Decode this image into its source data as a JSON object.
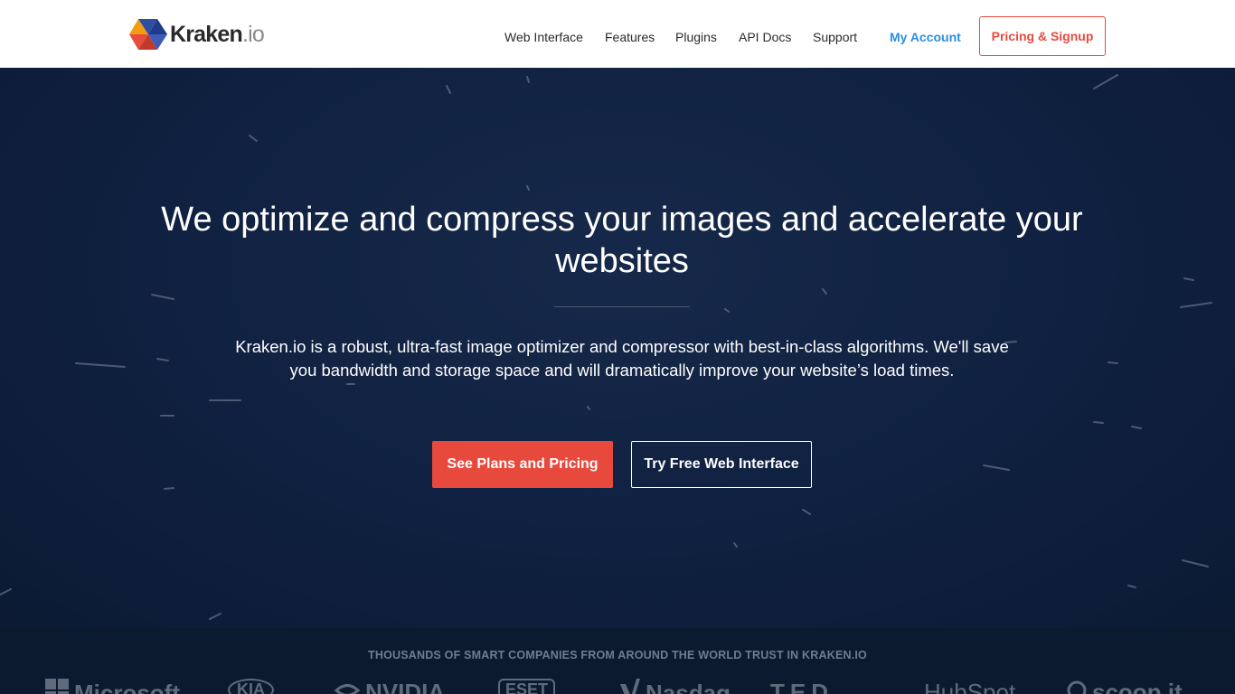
{
  "header": {
    "logo": {
      "name": "Kraken",
      "suffix": ".io"
    },
    "nav": [
      {
        "label": "Web Interface"
      },
      {
        "label": "Features"
      },
      {
        "label": "Plugins"
      },
      {
        "label": "API Docs"
      },
      {
        "label": "Support"
      }
    ],
    "account_label": "My Account",
    "signup_label": "Pricing & Signup"
  },
  "hero": {
    "title": "We optimize and compress your images and accelerate your websites",
    "description": "Kraken.io is a robust, ultra-fast image optimizer and compressor with best-in-class algorithms. We'll save you bandwidth and storage space and will dramatically improve your website’s load times.",
    "primary_button": "See Plans and Pricing",
    "secondary_button": "Try Free Web Interface"
  },
  "trust": {
    "title": "THOUSANDS OF SMART COMPANIES FROM AROUND THE WORLD TRUST IN KRAKEN.IO",
    "brands": [
      "Microsoft",
      "KIA",
      "NVIDIA",
      "ESET",
      "Nasdaq",
      "TED",
      "HubSpot",
      "scoop.it"
    ]
  },
  "colors": {
    "accent": "#e8493d",
    "link_blue": "#2b8fe0",
    "hero_bg": "#0f2040"
  }
}
